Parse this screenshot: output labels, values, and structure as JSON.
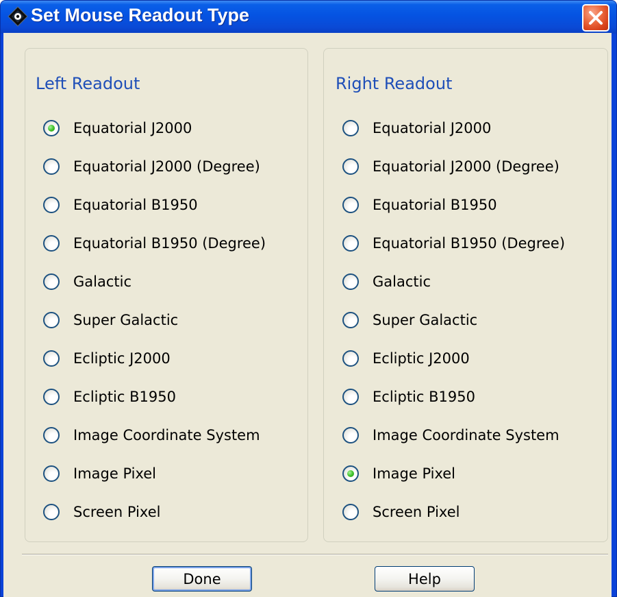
{
  "window": {
    "title": "Set Mouse Readout Type",
    "close_icon": "close-x-icon",
    "app_icon": "diamond-app-icon",
    "colors": {
      "title_bar": "#0a5fe8",
      "close_button": "#e2532a",
      "dialog_background": "#ece9d8",
      "group_label": "#1f4fb8",
      "selected_radio": "#43c62e"
    }
  },
  "left_readout": {
    "label": "Left Readout",
    "selected_index": 0,
    "options": [
      "Equatorial J2000",
      "Equatorial J2000 (Degree)",
      "Equatorial B1950",
      "Equatorial B1950 (Degree)",
      "Galactic",
      "Super Galactic",
      "Ecliptic J2000",
      "Ecliptic B1950",
      "Image Coordinate System",
      "Image Pixel",
      "Screen Pixel"
    ]
  },
  "right_readout": {
    "label": "Right Readout",
    "selected_index": 9,
    "options": [
      "Equatorial J2000",
      "Equatorial J2000 (Degree)",
      "Equatorial B1950",
      "Equatorial B1950 (Degree)",
      "Galactic",
      "Super Galactic",
      "Ecliptic J2000",
      "Ecliptic B1950",
      "Image Coordinate System",
      "Image Pixel",
      "Screen Pixel"
    ]
  },
  "buttons": {
    "done": "Done",
    "help": "Help"
  }
}
